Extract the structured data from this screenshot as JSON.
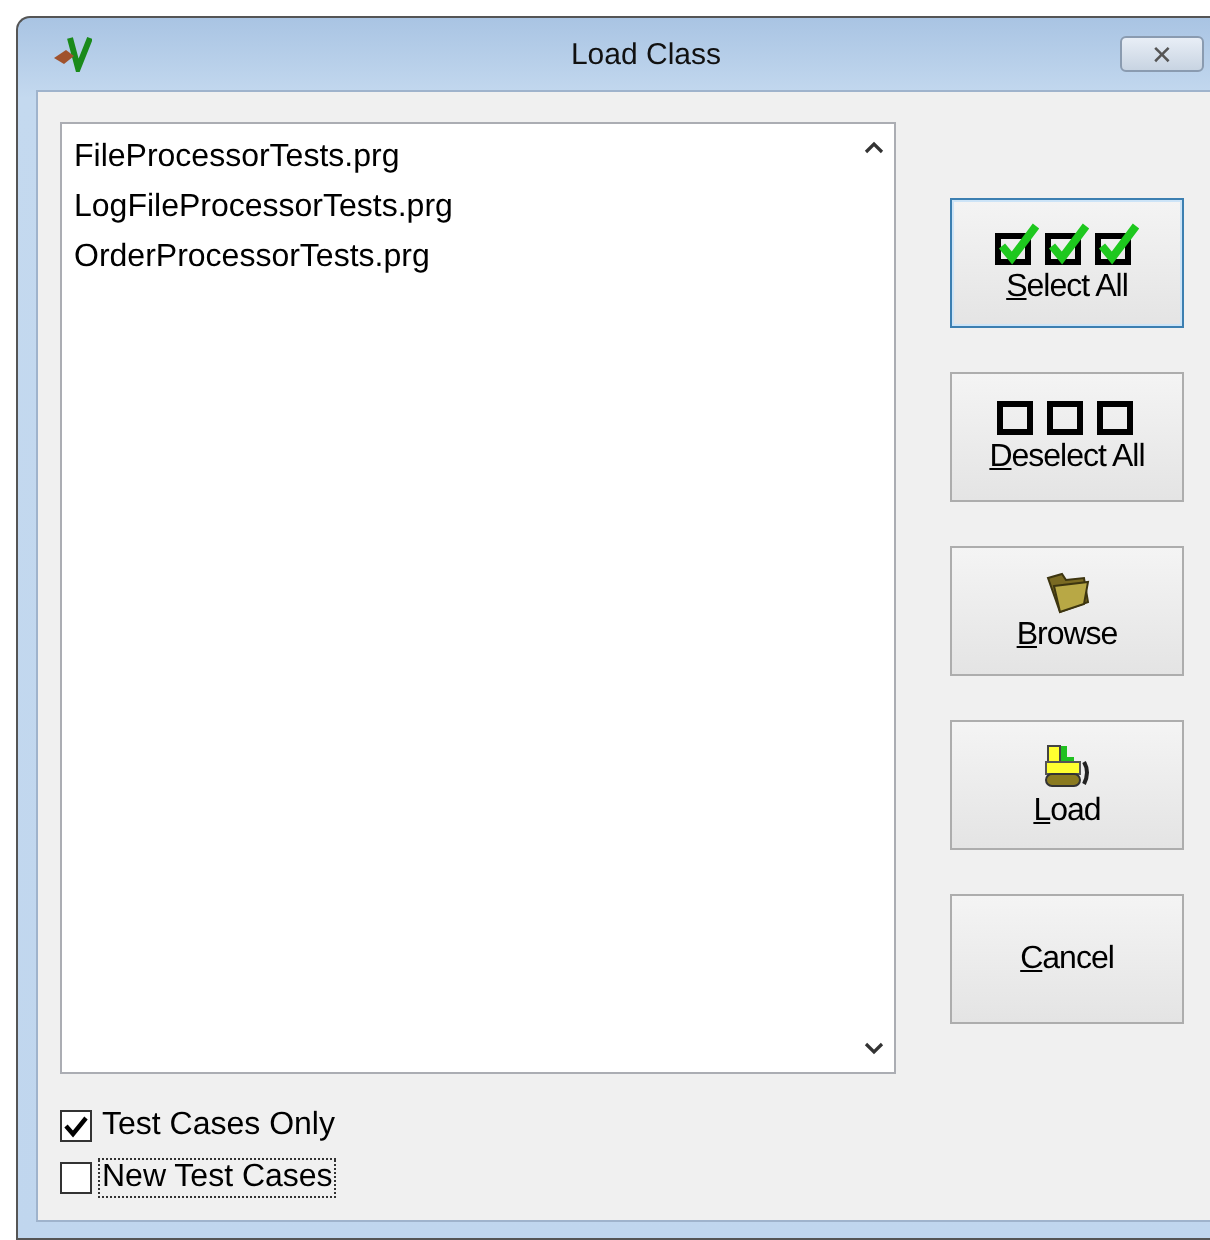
{
  "window": {
    "title": "Load Class",
    "close_label": "✕"
  },
  "file_list": {
    "items": [
      {
        "label": "FileProcessorTests.prg",
        "selected": false
      },
      {
        "label": "LogFileProcessorTests.prg",
        "selected": false
      },
      {
        "label": "OrderProcessorTests.prg",
        "selected": false
      }
    ]
  },
  "buttons": [
    {
      "kind": "select_all",
      "label": "Select All",
      "focused": true
    },
    {
      "kind": "deselect_all",
      "label": "Deselect All",
      "focused": false
    },
    {
      "kind": "browse",
      "label": "Browse",
      "focused": false
    },
    {
      "kind": "load",
      "label": "Load",
      "focused": false
    },
    {
      "kind": "cancel",
      "label": "Cancel",
      "focused": false
    }
  ],
  "checkboxes": [
    {
      "label": "Test Cases Only",
      "checked": true,
      "focused": false
    },
    {
      "label": "New Test Cases",
      "checked": false,
      "focused": true
    }
  ]
}
